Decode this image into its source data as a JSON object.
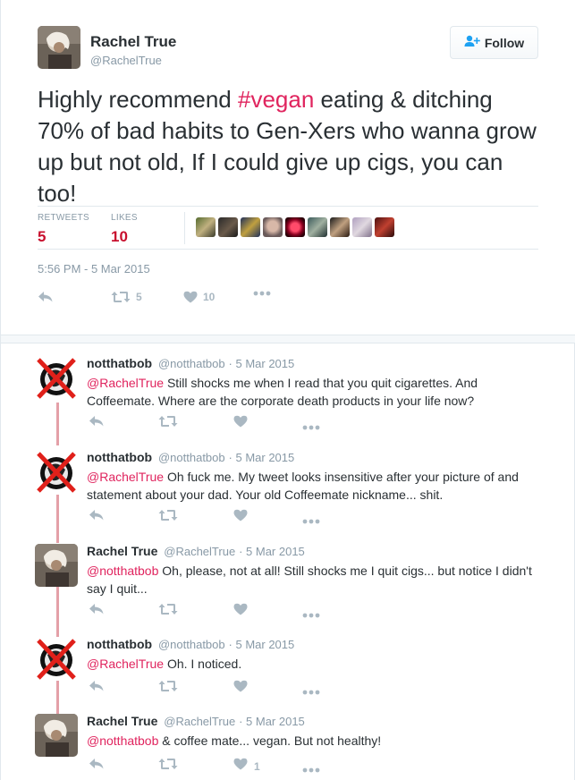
{
  "main_tweet": {
    "name": "Rachel True",
    "handle": "@RachelTrue",
    "follow_label": "Follow",
    "text_before": "Highly recommend ",
    "hashtag": "#vegan",
    "text_after": " eating & ditching 70% of bad habits to Gen-Xers who wanna grow up but not old, If I could give up cigs, you can too!",
    "retweets_label": "RETWEETS",
    "retweets_value": "5",
    "likes_label": "LIKES",
    "likes_value": "10",
    "timestamp": "5:56 PM - 5 Mar 2015",
    "retweet_count": "5",
    "like_count": "10"
  },
  "colors": {
    "accent": "#e0245e",
    "stat_value": "#c8102e",
    "muted": "#8899a6",
    "icon": "#aab8c2",
    "thread_line": "#e4a0a8"
  },
  "replies": [
    {
      "name": "notthatbob",
      "handle": "@notthatbob",
      "date": "· 5 Mar 2015",
      "mention": "@RachelTrue",
      "text": " Still shocks me when I read that you quit cigarettes. And Coffeemate. Where are the corporate death products in your life now?",
      "like_count": ""
    },
    {
      "name": "notthatbob",
      "handle": "@notthatbob",
      "date": "· 5 Mar 2015",
      "mention": "@RachelTrue",
      "text": " Oh fuck me. My tweet looks insensitive after your picture of and statement about your dad. Your old Coffeemate nickname... shit.",
      "like_count": ""
    },
    {
      "name": "Rachel True",
      "handle": "@RachelTrue",
      "date": "· 5 Mar 2015",
      "mention": "@notthatbob",
      "text": " Oh, please, not at all! Still shocks me I quit cigs... but notice I didn't say I quit...",
      "like_count": ""
    },
    {
      "name": "notthatbob",
      "handle": "@notthatbob",
      "date": "· 5 Mar 2015",
      "mention": "@RachelTrue",
      "text": " Oh. I noticed.",
      "like_count": ""
    },
    {
      "name": "Rachel True",
      "handle": "@RachelTrue",
      "date": "· 5 Mar 2015",
      "mention": "@notthatbob",
      "text": " & coffee mate... vegan.  But not healthy!",
      "like_count": "1"
    }
  ],
  "icons": [
    "reply-icon",
    "retweet-icon",
    "heart-icon",
    "more-icon",
    "follow-person-icon"
  ]
}
